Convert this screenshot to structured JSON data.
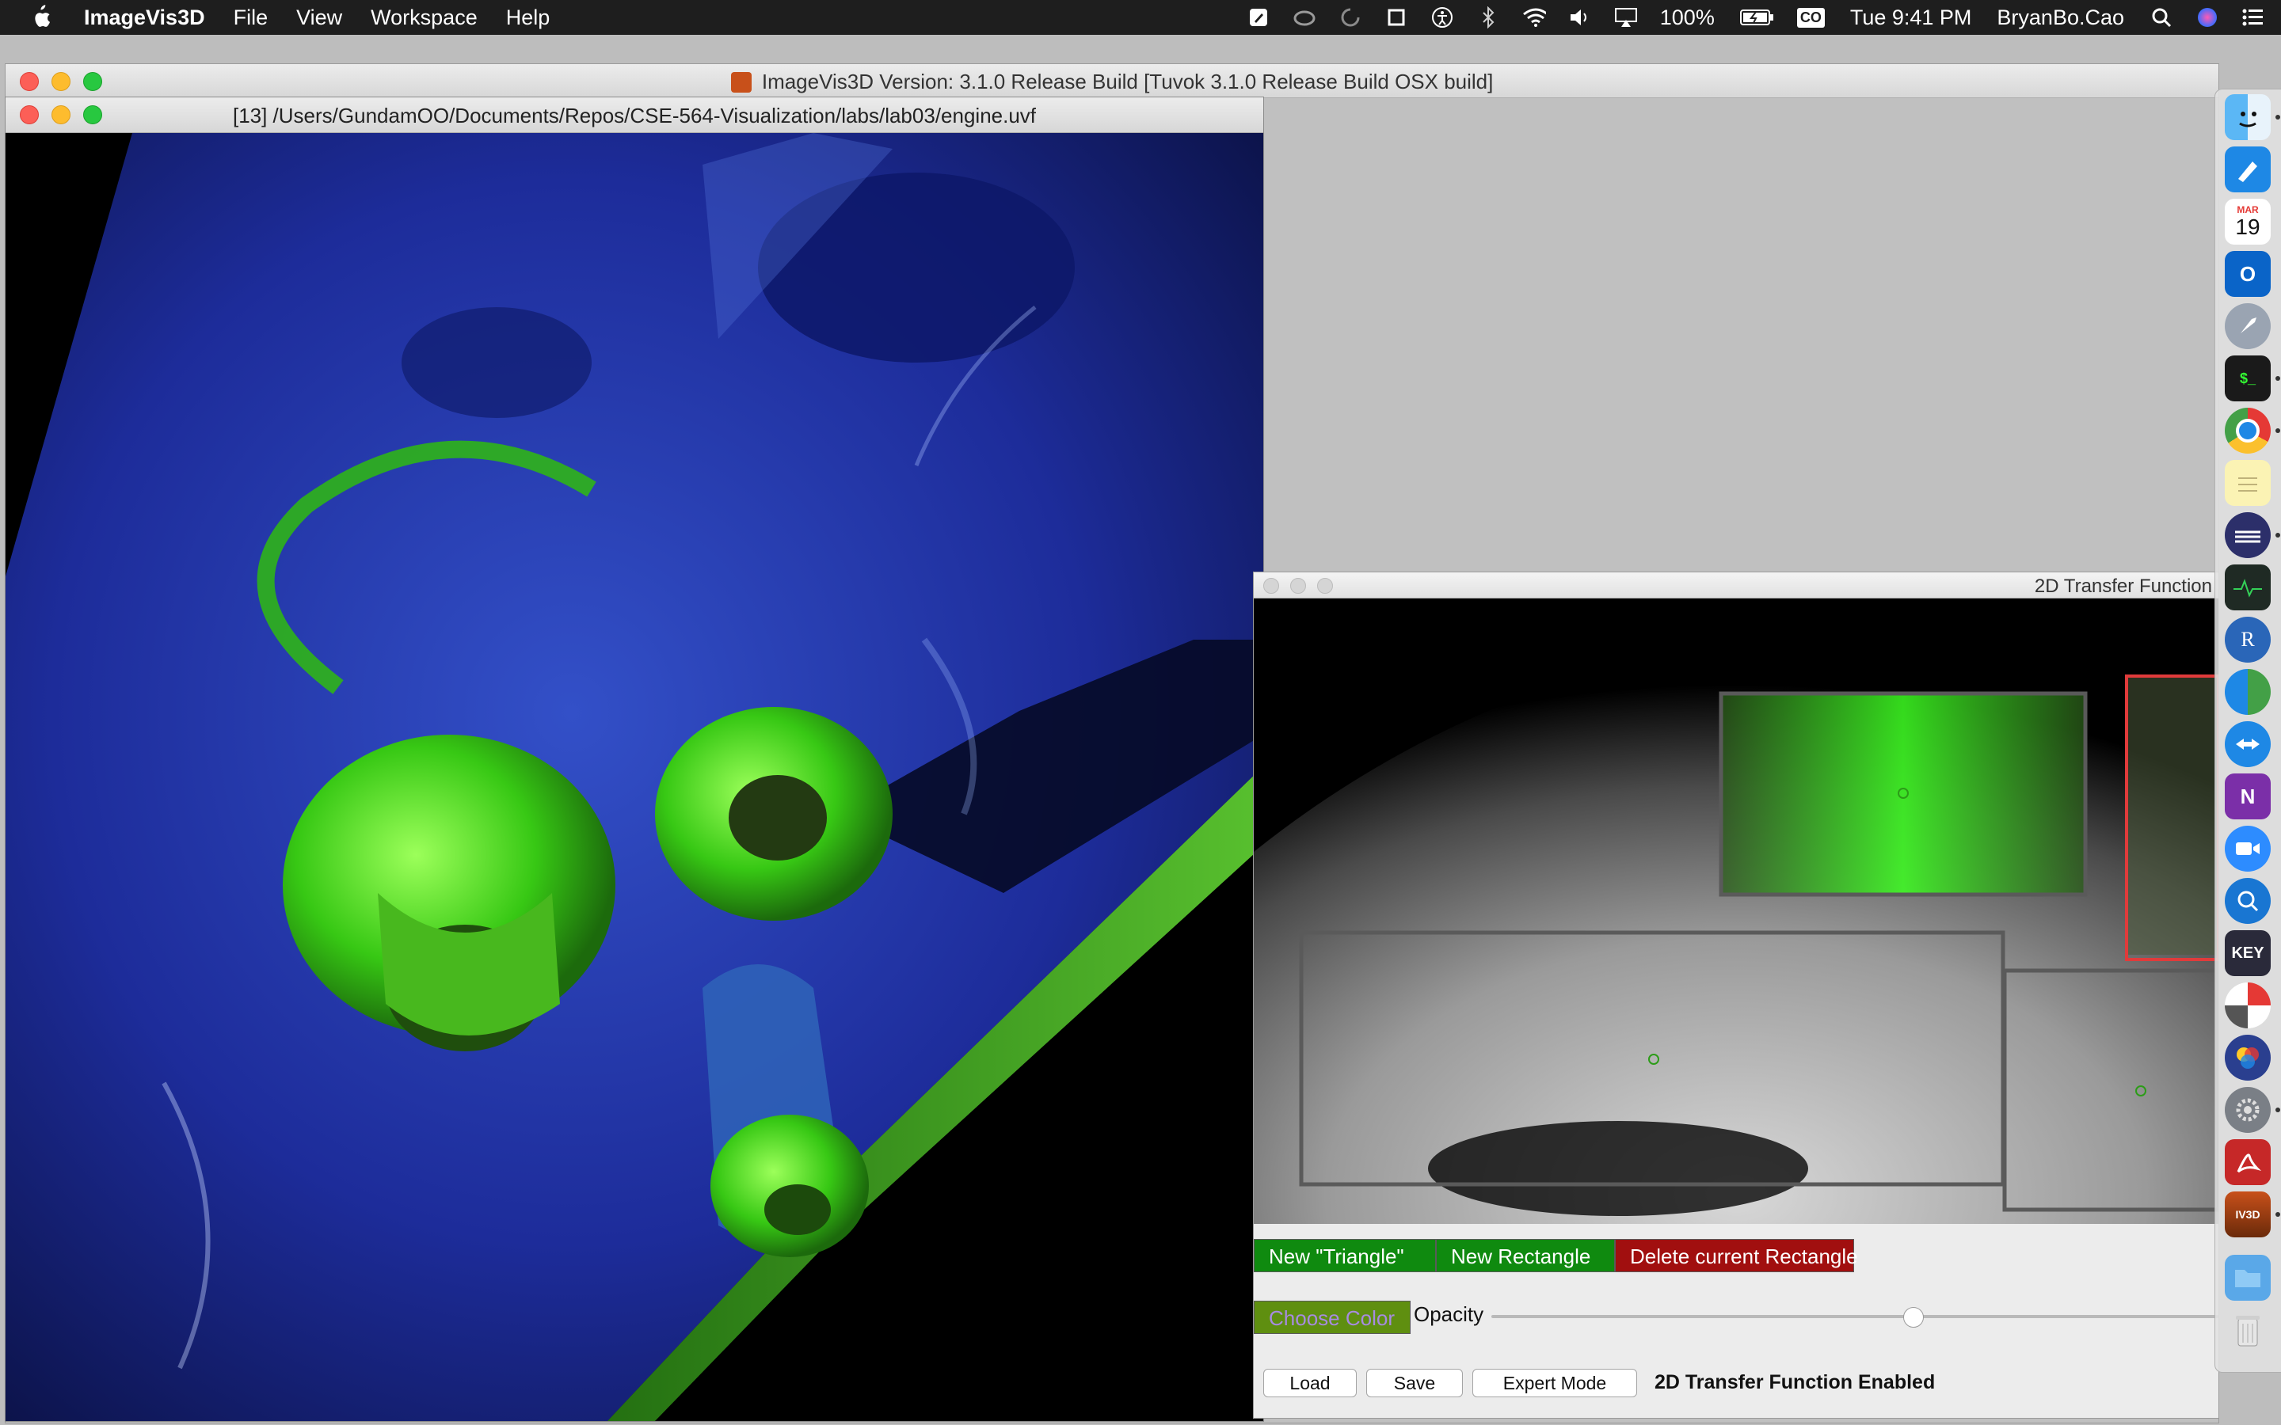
{
  "menubar": {
    "app_name": "ImageVis3D",
    "menus": [
      "File",
      "View",
      "Workspace",
      "Help"
    ],
    "battery": "100%",
    "input_source": "CO",
    "clock": "Tue 9:41 PM",
    "user": "BryanBo.Cao"
  },
  "main_window": {
    "title": "ImageVis3D Version: 3.1.0 Release Build [Tuvok 3.1.0 Release Build OSX build]"
  },
  "render_window": {
    "title": "[13] /Users/GundamOO/Documents/Repos/CSE-564-Visualization/labs/lab03/engine.uvf"
  },
  "tf_window": {
    "title": "2D Transfer Function",
    "buttons": {
      "new_triangle": "New \"Triangle\"",
      "new_rectangle": "New Rectangle",
      "delete_rectangle": "Delete current Rectangle",
      "choose_color": "Choose Color",
      "load": "Load",
      "save": "Save",
      "expert_mode": "Expert Mode"
    },
    "opacity_label": "Opacity",
    "opacity_value": 0.58,
    "status": "2D Transfer Function Enabled"
  },
  "dock": {
    "calendar_month": "MAR",
    "calendar_day": "19",
    "keynote_label": "KEY",
    "items": [
      "finder",
      "pen",
      "calendar",
      "outlook",
      "rocket",
      "terminal",
      "chrome",
      "notes",
      "eclipse",
      "activity-monitor",
      "r",
      "xcode-helper",
      "teamviewer",
      "onenote",
      "zoom",
      "safari-search",
      "keynote",
      "daisydisk",
      "color-ui",
      "system-preferences",
      "acrobat",
      "imagevis3d",
      "downloads",
      "trash"
    ]
  },
  "colors": {
    "accent_green": "#0f8a0f",
    "delete_red": "#a10f0f",
    "tf_selected_border": "#e03b3b"
  }
}
